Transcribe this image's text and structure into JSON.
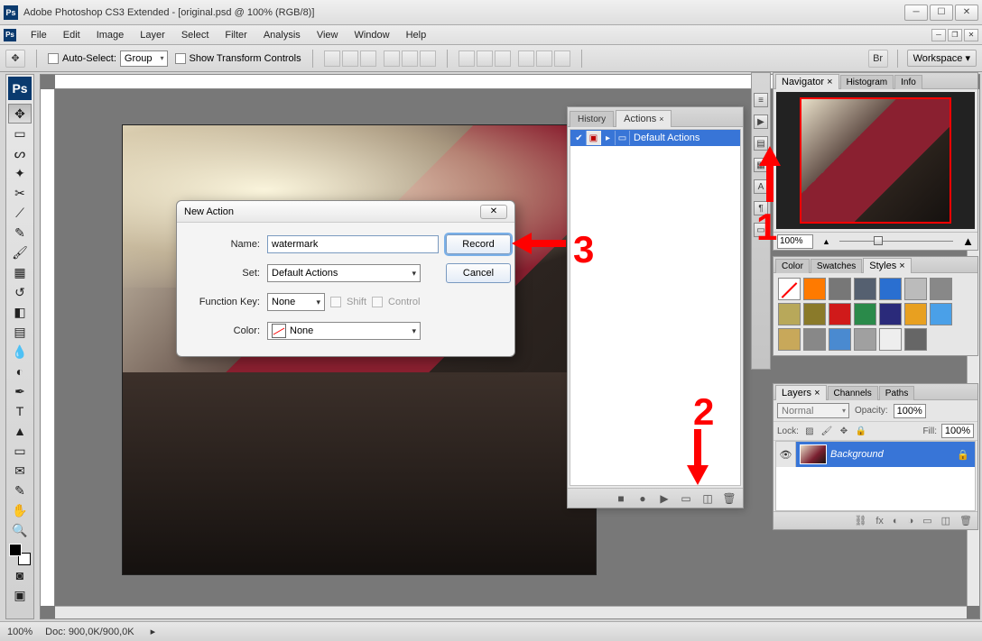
{
  "titlebar": {
    "app_name": "Adobe Photoshop CS3 Extended",
    "document": "[original.psd @ 100% (RGB/8)]",
    "full_title": "Adobe Photoshop CS3 Extended - [original.psd @ 100% (RGB/8)]"
  },
  "menu": [
    "File",
    "Edit",
    "Image",
    "Layer",
    "Select",
    "Filter",
    "Analysis",
    "View",
    "Window",
    "Help"
  ],
  "options": {
    "auto_select_label": "Auto-Select:",
    "auto_select_value": "Group",
    "show_transform_label": "Show Transform Controls",
    "workspace_label": "Workspace ▾"
  },
  "status": {
    "zoom": "100%",
    "doc": "Doc: 900,0K/900,0K"
  },
  "dialog": {
    "title": "New Action",
    "labels": {
      "name": "Name:",
      "set": "Set:",
      "fkey": "Function Key:",
      "shift": "Shift",
      "ctrl": "Control",
      "color": "Color:"
    },
    "values": {
      "name": "watermark",
      "set": "Default Actions",
      "fkey": "None",
      "color": "None"
    },
    "buttons": {
      "record": "Record",
      "cancel": "Cancel"
    }
  },
  "actions_panel": {
    "tabs": [
      "History",
      "Actions"
    ],
    "active_tab": "Actions",
    "item": "Default Actions"
  },
  "navigator": {
    "tabs": [
      "Navigator",
      "Histogram",
      "Info"
    ],
    "zoom": "100%"
  },
  "styles_panel": {
    "tabs": [
      "Color",
      "Swatches",
      "Styles"
    ],
    "swatches": [
      "#ffffff",
      "#ff7a00",
      "#777777",
      "#556070",
      "#2a6fd0",
      "#bbbbbb",
      "#888888",
      "#b8a85a",
      "#8a7a2a",
      "#d01a1a",
      "#2a8a4a",
      "#2a2a7a",
      "#e8a020",
      "#4aa0e8",
      "#c8a85a",
      "#888888",
      "#4a8ad0",
      "#a0a0a0",
      "#eeeeee",
      "#666666"
    ]
  },
  "layers_panel": {
    "tabs": [
      "Layers",
      "Channels",
      "Paths"
    ],
    "blend_mode": "Normal",
    "opacity_label": "Opacity:",
    "opacity_value": "100%",
    "lock_label": "Lock:",
    "fill_label": "Fill:",
    "fill_value": "100%",
    "layer_name": "Background"
  },
  "annotations": {
    "a1": "1",
    "a2": "2",
    "a3": "3"
  }
}
